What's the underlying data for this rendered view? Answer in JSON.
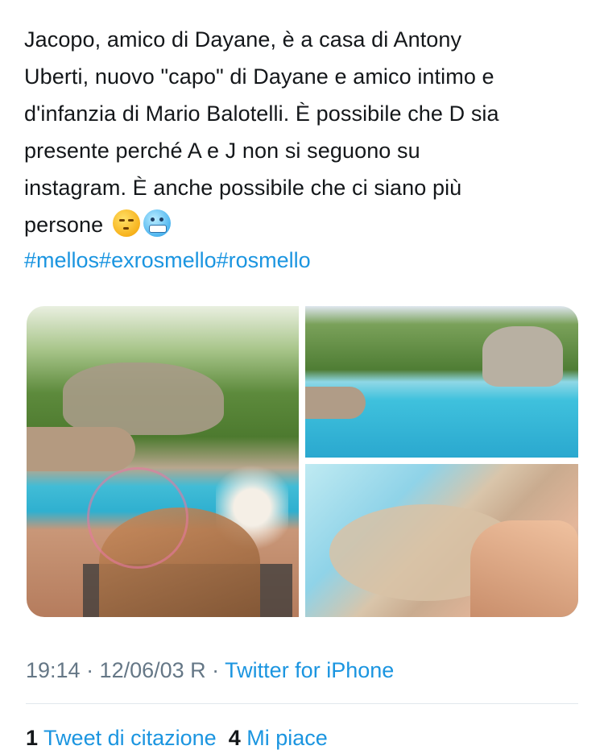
{
  "tweet": {
    "lines": [
      "Jacopo, amico di Dayane, è a casa di Antony",
      "Uberti, nuovo \"capo\" di Dayane e amico intimo e",
      "d'infanzia di Mario Balotelli. È possibile che D sia",
      "presente perché A e J non si seguono su",
      "instagram. È anche possibile che ci siano più",
      "persone"
    ],
    "emojis": [
      "smirking-face-icon",
      "cold-face-icon"
    ],
    "hashtags": [
      "#mellos",
      "#exrosmello",
      "#rosmello"
    ]
  },
  "meta": {
    "timestamp": "19:14 · 12/06/03 R · ",
    "source": "Twitter for iPhone"
  },
  "stats": {
    "quote_count": "1",
    "quote_label": " Tweet di citazione",
    "likes_count": "4",
    "likes_label": " Mi piace"
  }
}
